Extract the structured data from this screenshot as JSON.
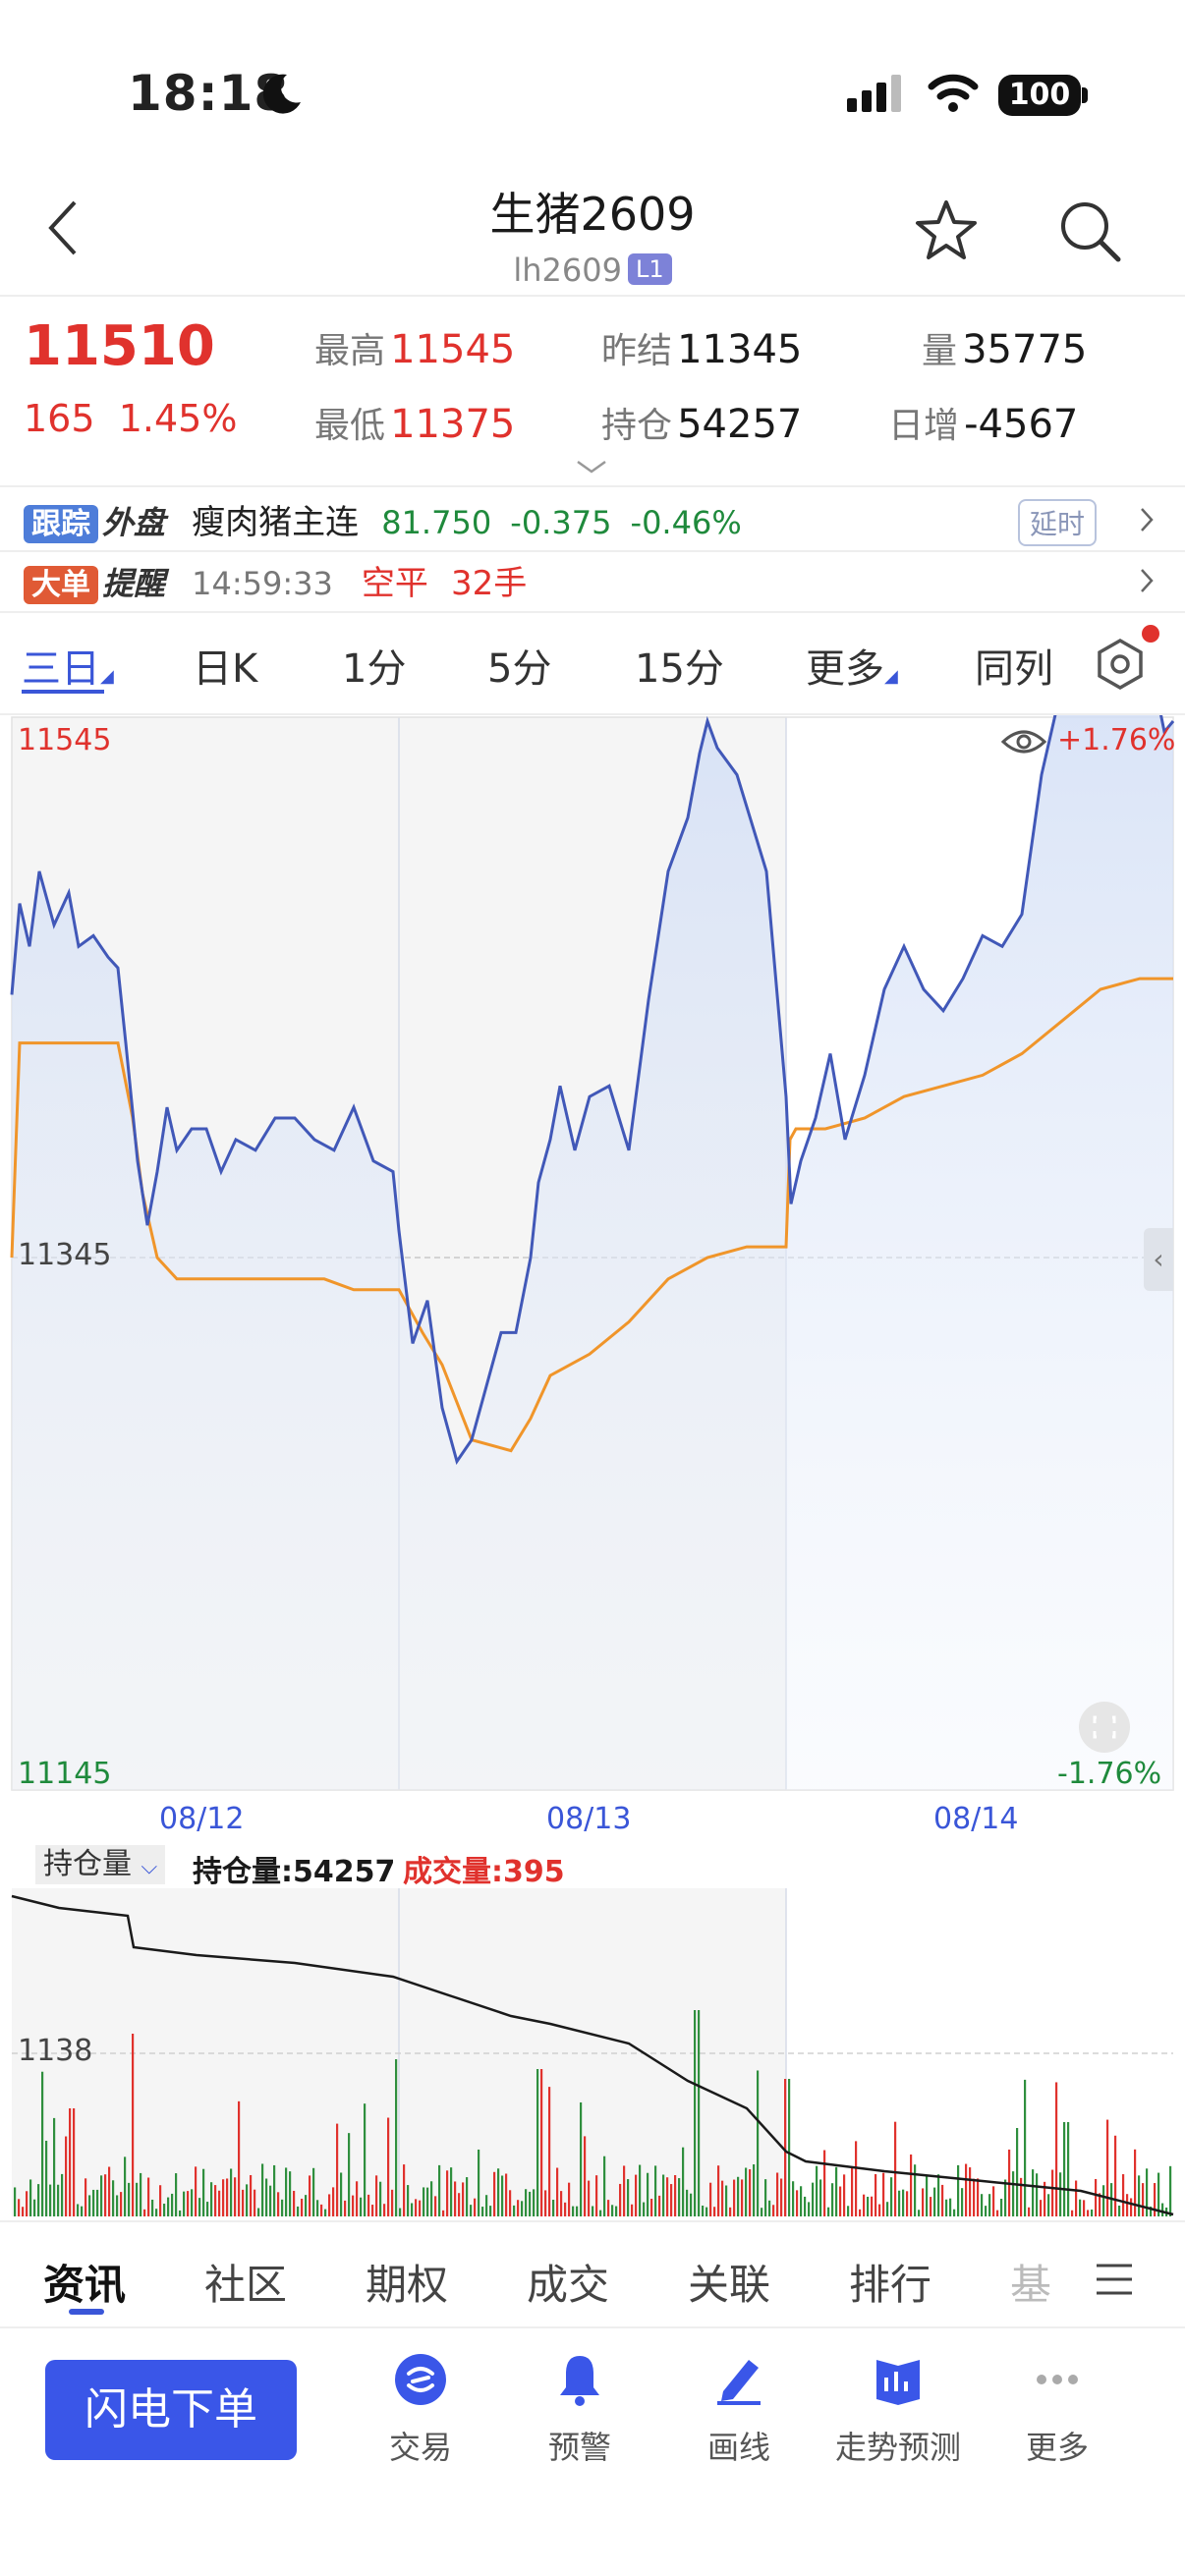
{
  "status": {
    "time": "18:18",
    "battery": "100"
  },
  "header": {
    "title": "生猪2609",
    "code": "lh2609",
    "badge": "L1"
  },
  "quote": {
    "last": "11510",
    "change": "165",
    "change_pct": "1.45%",
    "high_label": "最高",
    "high": "11545",
    "low_label": "最低",
    "low": "11375",
    "prev_label": "昨结",
    "prev": "11345",
    "oi_label": "持仓",
    "oi": "54257",
    "vol_label": "量",
    "vol": "35775",
    "daily_label": "日增",
    "daily": "-4567"
  },
  "ticker": {
    "tag1a": "跟踪",
    "tag1b": "外盘",
    "name": "瘦肉猪主连",
    "price": "81.750",
    "chg": "-0.375",
    "pct": "-0.46%",
    "delay": "延时",
    "tag2a": "大单",
    "tag2b": "提醒",
    "time": "14:59:33",
    "action": "空平",
    "qty": "32手"
  },
  "chart_tabs": [
    "三日",
    "日K",
    "1分",
    "5分",
    "15分",
    "更多",
    "同列"
  ],
  "price_chart": {
    "y_top": "11545",
    "y_mid": "11345",
    "y_bot": "11145",
    "pct_top": "+1.76%",
    "pct_bot": "-1.76%",
    "dates": [
      "08/12",
      "08/13",
      "08/14"
    ]
  },
  "volume_chart": {
    "selector": "持仓量",
    "oi_text": "持仓量:54257",
    "vol_text": "成交量:395",
    "y_label": "1138"
  },
  "sub_tabs": [
    "资讯",
    "社区",
    "期权",
    "成交",
    "关联",
    "排行",
    "基"
  ],
  "bottom_nav": {
    "flash": "闪电下单",
    "items": [
      "交易",
      "预警",
      "画线",
      "走势预测",
      "更多"
    ]
  },
  "colors": {
    "accent": "#3a56e8",
    "up": "#e0322d",
    "down": "#1f8a3c",
    "price_line": "#4158b8",
    "avg_line": "#f0952a"
  }
}
